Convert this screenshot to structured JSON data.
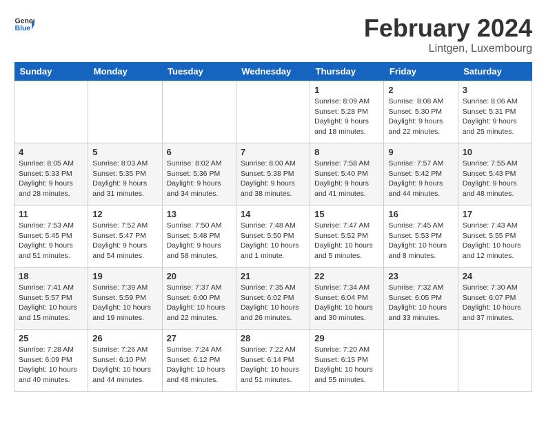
{
  "header": {
    "logo_general": "General",
    "logo_blue": "Blue",
    "month_year": "February 2024",
    "location": "Lintgen, Luxembourg"
  },
  "days_of_week": [
    "Sunday",
    "Monday",
    "Tuesday",
    "Wednesday",
    "Thursday",
    "Friday",
    "Saturday"
  ],
  "weeks": [
    [
      {
        "day": "",
        "info": ""
      },
      {
        "day": "",
        "info": ""
      },
      {
        "day": "",
        "info": ""
      },
      {
        "day": "",
        "info": ""
      },
      {
        "day": "1",
        "info": "Sunrise: 8:09 AM\nSunset: 5:28 PM\nDaylight: 9 hours\nand 18 minutes."
      },
      {
        "day": "2",
        "info": "Sunrise: 8:08 AM\nSunset: 5:30 PM\nDaylight: 9 hours\nand 22 minutes."
      },
      {
        "day": "3",
        "info": "Sunrise: 8:06 AM\nSunset: 5:31 PM\nDaylight: 9 hours\nand 25 minutes."
      }
    ],
    [
      {
        "day": "4",
        "info": "Sunrise: 8:05 AM\nSunset: 5:33 PM\nDaylight: 9 hours\nand 28 minutes."
      },
      {
        "day": "5",
        "info": "Sunrise: 8:03 AM\nSunset: 5:35 PM\nDaylight: 9 hours\nand 31 minutes."
      },
      {
        "day": "6",
        "info": "Sunrise: 8:02 AM\nSunset: 5:36 PM\nDaylight: 9 hours\nand 34 minutes."
      },
      {
        "day": "7",
        "info": "Sunrise: 8:00 AM\nSunset: 5:38 PM\nDaylight: 9 hours\nand 38 minutes."
      },
      {
        "day": "8",
        "info": "Sunrise: 7:58 AM\nSunset: 5:40 PM\nDaylight: 9 hours\nand 41 minutes."
      },
      {
        "day": "9",
        "info": "Sunrise: 7:57 AM\nSunset: 5:42 PM\nDaylight: 9 hours\nand 44 minutes."
      },
      {
        "day": "10",
        "info": "Sunrise: 7:55 AM\nSunset: 5:43 PM\nDaylight: 9 hours\nand 48 minutes."
      }
    ],
    [
      {
        "day": "11",
        "info": "Sunrise: 7:53 AM\nSunset: 5:45 PM\nDaylight: 9 hours\nand 51 minutes."
      },
      {
        "day": "12",
        "info": "Sunrise: 7:52 AM\nSunset: 5:47 PM\nDaylight: 9 hours\nand 54 minutes."
      },
      {
        "day": "13",
        "info": "Sunrise: 7:50 AM\nSunset: 5:48 PM\nDaylight: 9 hours\nand 58 minutes."
      },
      {
        "day": "14",
        "info": "Sunrise: 7:48 AM\nSunset: 5:50 PM\nDaylight: 10 hours\nand 1 minute."
      },
      {
        "day": "15",
        "info": "Sunrise: 7:47 AM\nSunset: 5:52 PM\nDaylight: 10 hours\nand 5 minutes."
      },
      {
        "day": "16",
        "info": "Sunrise: 7:45 AM\nSunset: 5:53 PM\nDaylight: 10 hours\nand 8 minutes."
      },
      {
        "day": "17",
        "info": "Sunrise: 7:43 AM\nSunset: 5:55 PM\nDaylight: 10 hours\nand 12 minutes."
      }
    ],
    [
      {
        "day": "18",
        "info": "Sunrise: 7:41 AM\nSunset: 5:57 PM\nDaylight: 10 hours\nand 15 minutes."
      },
      {
        "day": "19",
        "info": "Sunrise: 7:39 AM\nSunset: 5:59 PM\nDaylight: 10 hours\nand 19 minutes."
      },
      {
        "day": "20",
        "info": "Sunrise: 7:37 AM\nSunset: 6:00 PM\nDaylight: 10 hours\nand 22 minutes."
      },
      {
        "day": "21",
        "info": "Sunrise: 7:35 AM\nSunset: 6:02 PM\nDaylight: 10 hours\nand 26 minutes."
      },
      {
        "day": "22",
        "info": "Sunrise: 7:34 AM\nSunset: 6:04 PM\nDaylight: 10 hours\nand 30 minutes."
      },
      {
        "day": "23",
        "info": "Sunrise: 7:32 AM\nSunset: 6:05 PM\nDaylight: 10 hours\nand 33 minutes."
      },
      {
        "day": "24",
        "info": "Sunrise: 7:30 AM\nSunset: 6:07 PM\nDaylight: 10 hours\nand 37 minutes."
      }
    ],
    [
      {
        "day": "25",
        "info": "Sunrise: 7:28 AM\nSunset: 6:09 PM\nDaylight: 10 hours\nand 40 minutes."
      },
      {
        "day": "26",
        "info": "Sunrise: 7:26 AM\nSunset: 6:10 PM\nDaylight: 10 hours\nand 44 minutes."
      },
      {
        "day": "27",
        "info": "Sunrise: 7:24 AM\nSunset: 6:12 PM\nDaylight: 10 hours\nand 48 minutes."
      },
      {
        "day": "28",
        "info": "Sunrise: 7:22 AM\nSunset: 6:14 PM\nDaylight: 10 hours\nand 51 minutes."
      },
      {
        "day": "29",
        "info": "Sunrise: 7:20 AM\nSunset: 6:15 PM\nDaylight: 10 hours\nand 55 minutes."
      },
      {
        "day": "",
        "info": ""
      },
      {
        "day": "",
        "info": ""
      }
    ]
  ]
}
